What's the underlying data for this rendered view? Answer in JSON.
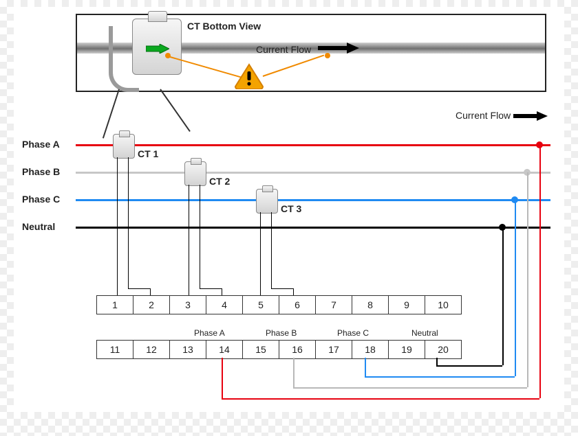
{
  "detail": {
    "title": "CT Bottom View",
    "flow_label": "Current Flow",
    "arrow_green_name": "ct-orientation-arrow",
    "warning_name": "orientation-warning"
  },
  "legend": {
    "flow_label": "Current Flow"
  },
  "phases": {
    "a": {
      "label": "Phase A",
      "color": "#e7000f"
    },
    "b": {
      "label": "Phase B",
      "color": "#c7c7c7"
    },
    "c": {
      "label": "Phase C",
      "color": "#1f8af2"
    },
    "n": {
      "label": "Neutral",
      "color": "#000000"
    }
  },
  "cts": {
    "1": {
      "label": "CT 1"
    },
    "2": {
      "label": "CT 2"
    },
    "3": {
      "label": "CT 3"
    }
  },
  "terminal_rows": {
    "top": [
      "1",
      "2",
      "3",
      "4",
      "5",
      "6",
      "7",
      "8",
      "9",
      "10"
    ],
    "bottom": [
      "11",
      "12",
      "13",
      "14",
      "15",
      "16",
      "17",
      "18",
      "19",
      "20"
    ]
  },
  "terminal_labels": {
    "phase_a": "Phase A",
    "phase_b": "Phase B",
    "phase_c": "Phase C",
    "neutral": "Neutral"
  }
}
